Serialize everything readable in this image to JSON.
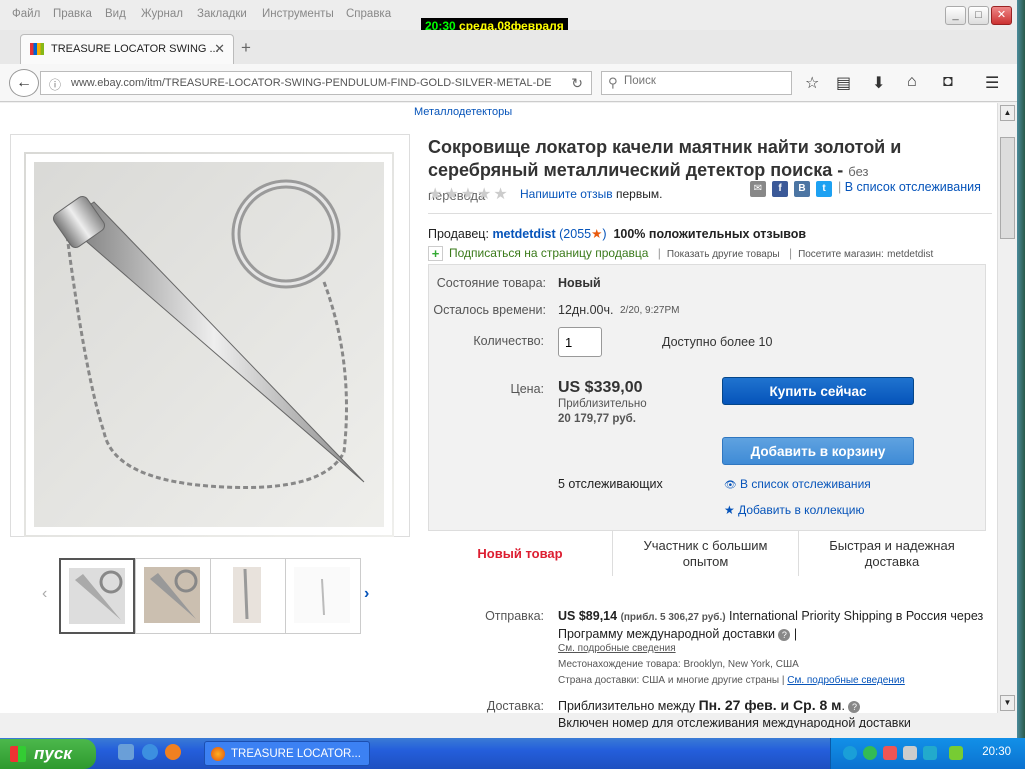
{
  "menu": [
    "Файл",
    "Правка",
    "Вид",
    "Журнал",
    "Закладки",
    "Инструменты",
    "Справка"
  ],
  "clock": {
    "time": "20:30",
    "date": "среда,08февраля"
  },
  "tab": {
    "title": "TREASURE LOCATOR SWING ..."
  },
  "url": "www.ebay.com/itm/TREASURE-LOCATOR-SWING-PENDULUM-FIND-GOLD-SILVER-METAL-DETECT",
  "search_placeholder": "Поиск",
  "breadcrumb": "Металлодетекторы",
  "product": {
    "title": "Сокровище локатор качели маятник найти золотой и серебряный металлический детектор поиска -",
    "no_translation": "без перевода",
    "review_link": "Напишите отзыв",
    "review_suffix": "первым.",
    "watchlist": "В список отслеживания"
  },
  "seller": {
    "label": "Продавец:",
    "name": "metdetdist",
    "score": "2055",
    "feedback": "100% положительных отзывов",
    "subscribe": "Подписаться на страницу продавца",
    "other_items": "Показать другие товары",
    "visit": "Посетите магазин:",
    "store": "metdetdist"
  },
  "details": {
    "condition_label": "Состояние товара:",
    "condition": "Новый",
    "time_label": "Осталось времени:",
    "time_left": "12дн.00ч.",
    "time_end": "2/20, 9:27PM",
    "qty_label": "Количество:",
    "qty": "1",
    "available": "Доступно более 10",
    "price_label": "Цена:",
    "price": "US $339,00",
    "approx_label": "Приблизительно",
    "approx_value": "20 179,77 руб.",
    "buy": "Купить сейчас",
    "cart": "Добавить в корзину",
    "watchers": "5 отслеживающих",
    "watch": "В список отслеживания",
    "collection": "Добавить в коллекцию"
  },
  "features": [
    "Новый товар",
    "Участник с большим опытом",
    "Быстрая и надежная доставка"
  ],
  "shipping": {
    "label": "Отправка:",
    "cost": "US $89,14",
    "approx": "(прибл. 5 306,27 руб.)",
    "method": "International Priority Shipping в Россия",
    "via": "через Программу международной доставки",
    "details": "См. подробные сведения",
    "location_label": "Местонахождение товара:",
    "location": "Brooklyn, New York, США",
    "countries_label": "Страна доставки:",
    "countries": "США и многие другие страны |",
    "countries_link": "См. подробные сведения",
    "delivery_label": "Доставка:",
    "delivery_pre": "Приблизительно между",
    "delivery_dates": "Пн. 27 фев. и Ср. 8 м",
    "tracking": "Включен номер для отслеживания международной доставки"
  },
  "taskbar": {
    "start": "пуск",
    "item": "TREASURE LOCATOR...",
    "time": "20:30"
  },
  "colors": {
    "link": "#0654ba",
    "buy": "#0654ba",
    "cart": "#3f8bd6",
    "feature_red": "#dd1e31"
  }
}
